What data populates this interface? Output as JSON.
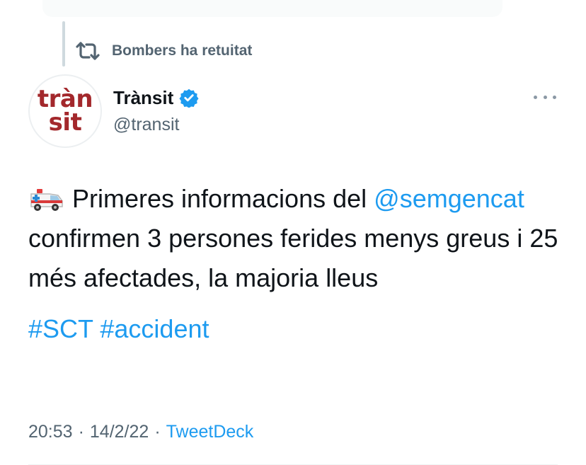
{
  "retweet": {
    "label": "Bombers ha retuitat",
    "icon": "retweet-icon"
  },
  "author": {
    "avatar_line1": "tràn",
    "avatar_line2": "sit",
    "display_name": "Trànsit",
    "handle": "@transit",
    "verified": true
  },
  "tweet": {
    "emoji": "ambulance-emoji",
    "text_part1": "Primeres informacions del",
    "mention": "@semgencat",
    "text_part2": "confirmen 3 persones ferides menys greus i 25 més afectades, la majoria lleus",
    "hashtag1": "#SCT",
    "hashtag2": "#accident"
  },
  "meta": {
    "time": "20:53",
    "separator": "·",
    "date": "14/2/22",
    "source": "TweetDeck"
  },
  "colors": {
    "link": "#1d9bf0",
    "secondary_text": "#536471",
    "avatar_brand": "#a3282c"
  }
}
